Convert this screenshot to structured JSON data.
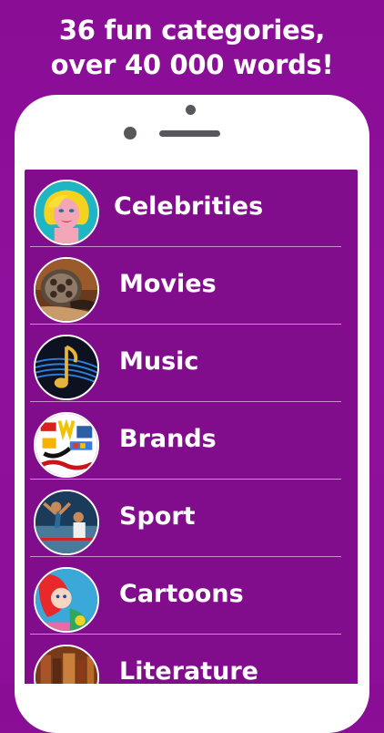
{
  "headline": {
    "line1": "36 fun categories,",
    "line2": "over 40 000 words!"
  },
  "categories": [
    {
      "label": "Celebrities",
      "icon": "celebrity-portrait-icon"
    },
    {
      "label": "Movies",
      "icon": "film-reel-icon"
    },
    {
      "label": "Music",
      "icon": "music-note-icon"
    },
    {
      "label": "Brands",
      "icon": "brand-logos-icon"
    },
    {
      "label": "Sport",
      "icon": "sprinter-icon"
    },
    {
      "label": "Cartoons",
      "icon": "mermaid-cartoon-icon"
    },
    {
      "label": "Literature",
      "icon": "books-icon"
    }
  ],
  "colors": {
    "background": "#8d0f99",
    "screen": "#810d8c",
    "text": "#ffffff"
  }
}
